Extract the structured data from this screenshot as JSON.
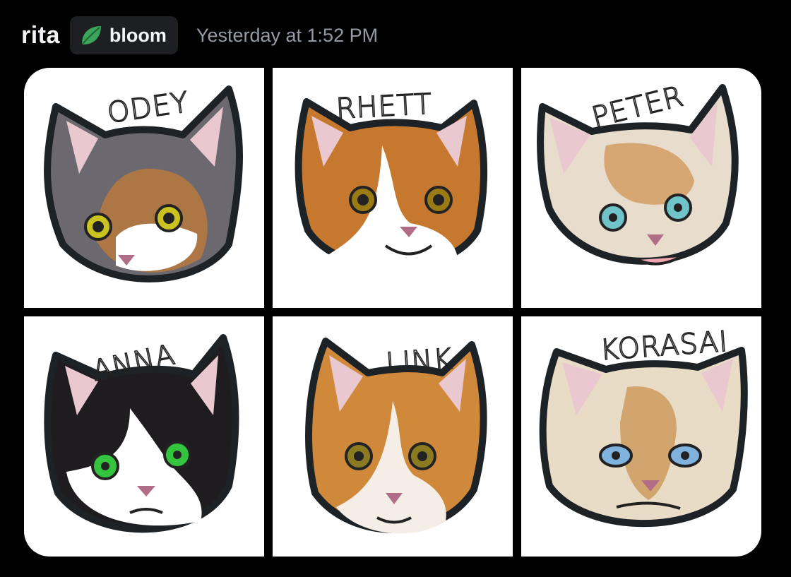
{
  "message": {
    "author": "rita",
    "tag": {
      "label": "bloom",
      "icon": "leaf-icon",
      "icon_color": "#3ba55c"
    },
    "timestamp": "Yesterday at 1:52 PM"
  },
  "gallery": {
    "images": [
      {
        "name": "ODEY",
        "fur": "#6b6870",
        "patch": "#b87a3d",
        "eye": "#c9c21f"
      },
      {
        "name": "RHETT",
        "fur": "#c6782e",
        "patch": "#ffffff",
        "eye": "#9a7a14"
      },
      {
        "name": "PETER",
        "fur": "#e8dccc",
        "patch": "#d19a5c",
        "eye": "#6fc3c9"
      },
      {
        "name": "ANNA",
        "fur": "#1e1c1f",
        "patch": "#ffffff",
        "eye": "#34c43d"
      },
      {
        "name": "LINK",
        "fur": "#d0893b",
        "patch": "#f5eee6",
        "eye": "#8a7a22"
      },
      {
        "name": "KORASAI",
        "fur": "#e9dcc7",
        "patch": "#c99350",
        "eye": "#7fb2dd"
      }
    ]
  }
}
